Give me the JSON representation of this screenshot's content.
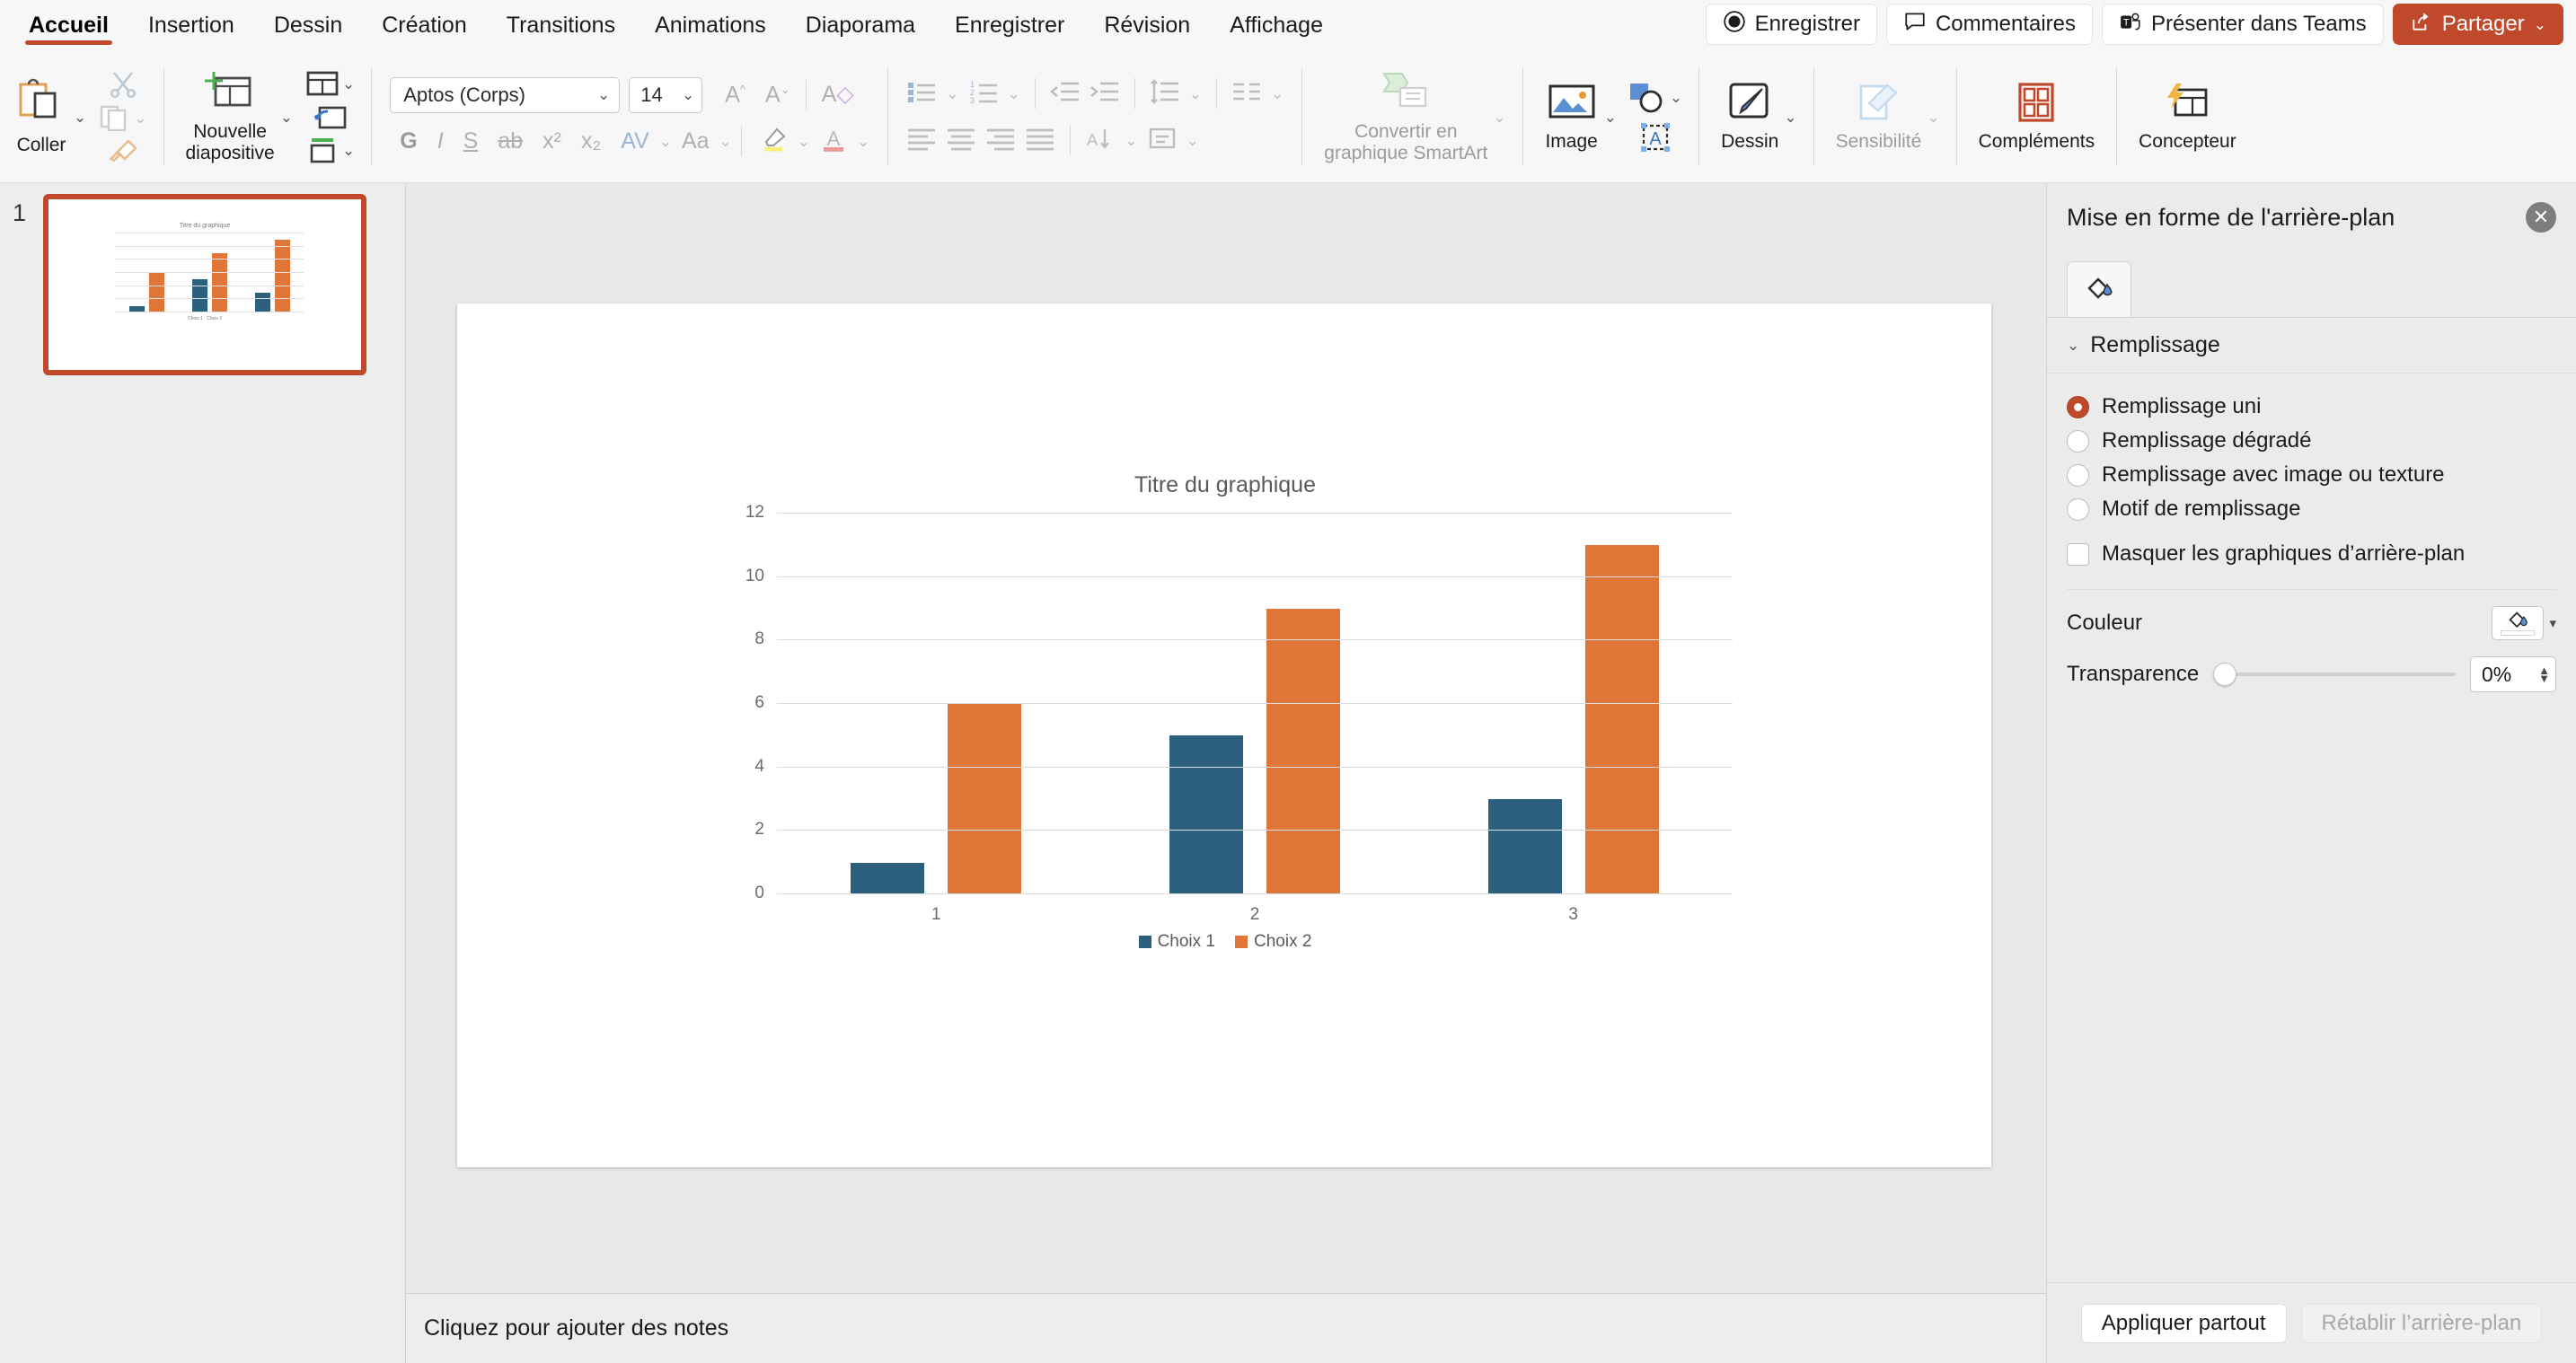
{
  "ribbon_tabs": [
    {
      "label": "Accueil",
      "active": true
    },
    {
      "label": "Insertion",
      "active": false
    },
    {
      "label": "Dessin",
      "active": false
    },
    {
      "label": "Création",
      "active": false
    },
    {
      "label": "Transitions",
      "active": false
    },
    {
      "label": "Animations",
      "active": false
    },
    {
      "label": "Diaporama",
      "active": false
    },
    {
      "label": "Enregistrer",
      "active": false
    },
    {
      "label": "Révision",
      "active": false
    },
    {
      "label": "Affichage",
      "active": false
    }
  ],
  "topright": {
    "record_label": "Enregistrer",
    "comments_label": "Commentaires",
    "teams_label": "Présenter dans Teams",
    "share_label": "Partager",
    "share_color": "#c0492b"
  },
  "toolbar": {
    "paste_label": "Coller",
    "new_slide_label": "Nouvelle\ndiapositive",
    "font_name": "Aptos (Corps)",
    "font_size": "14",
    "bold": "G",
    "italic": "I",
    "underline": "S",
    "strike": "ab",
    "superscript": "x²",
    "subscript": "x₂",
    "spacing": "AV",
    "case": "Aa",
    "smartart_label": "Convertir en\ngraphique SmartArt",
    "image_label": "Image",
    "drawing_label": "Dessin",
    "sensitivity_label": "Sensibilité",
    "addins_label": "Compléments",
    "designer_label": "Concepteur"
  },
  "slides_panel": {
    "slide_number": "1"
  },
  "notes": {
    "placeholder": "Cliquez pour ajouter des notes"
  },
  "format_panel": {
    "title": "Mise en forme de l'arrière-plan",
    "section_fill": "Remplissage",
    "options": [
      {
        "label": "Remplissage uni",
        "selected": true
      },
      {
        "label": "Remplissage dégradé",
        "selected": false
      },
      {
        "label": "Remplissage avec image ou texture",
        "selected": false
      },
      {
        "label": "Motif de remplissage",
        "selected": false
      }
    ],
    "hide_bg_graphics": "Masquer les graphiques d’arrière-plan",
    "color_label": "Couleur",
    "transparency_label": "Transparence",
    "transparency_value": "0%",
    "apply_all_label": "Appliquer partout",
    "reset_label": "Rétablir l’arrière-plan"
  },
  "chart_data": {
    "type": "bar",
    "title": "Titre du graphique",
    "categories": [
      "1",
      "2",
      "3"
    ],
    "series": [
      {
        "name": "Choix 1",
        "values": [
          1,
          5,
          3
        ],
        "color": "#2d5f7f"
      },
      {
        "name": "Choix 2",
        "values": [
          6,
          9,
          11
        ],
        "color": "#df7537"
      }
    ],
    "yticks": [
      0,
      2,
      4,
      6,
      8,
      10,
      12
    ],
    "ylim": [
      0,
      12
    ],
    "xlabel": "",
    "ylabel": "",
    "grid": true,
    "legend_position": "bottom"
  }
}
